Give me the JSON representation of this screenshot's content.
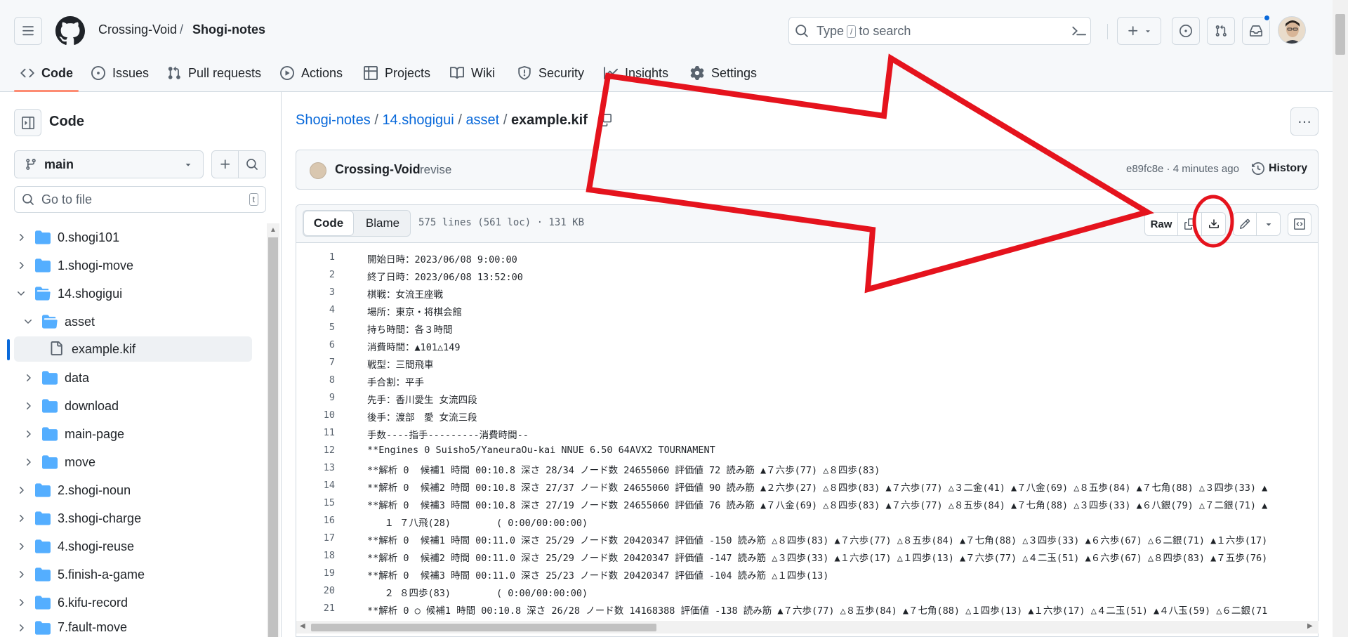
{
  "header": {
    "owner": "Crossing-Void",
    "separator": "/",
    "repo": "Shogi-notes",
    "search_placeholder_prefix": "Type",
    "search_key": "/",
    "search_placeholder_suffix": "to search",
    "create_icon": "plus-icon"
  },
  "nav": {
    "tabs": [
      {
        "label": "Code",
        "icon": "code-icon"
      },
      {
        "label": "Issues",
        "icon": "issue-icon"
      },
      {
        "label": "Pull requests",
        "icon": "pull-request-icon"
      },
      {
        "label": "Actions",
        "icon": "play-icon"
      },
      {
        "label": "Projects",
        "icon": "table-icon"
      },
      {
        "label": "Wiki",
        "icon": "book-icon"
      },
      {
        "label": "Security",
        "icon": "shield-icon"
      },
      {
        "label": "Insights",
        "icon": "graph-icon"
      },
      {
        "label": "Settings",
        "icon": "gear-icon"
      }
    ]
  },
  "sidebar": {
    "title": "Code",
    "branch": "main",
    "goto_placeholder": "Go to file",
    "goto_key": "t",
    "tree": [
      {
        "name": "0.shogi101"
      },
      {
        "name": "1.shogi-move"
      },
      {
        "name": "14.shogigui"
      },
      {
        "name": "asset"
      },
      {
        "name": "example.kif"
      },
      {
        "name": "data"
      },
      {
        "name": "download"
      },
      {
        "name": "main-page"
      },
      {
        "name": "move"
      },
      {
        "name": "2.shogi-noun"
      },
      {
        "name": "3.shogi-charge"
      },
      {
        "name": "4.shogi-reuse"
      },
      {
        "name": "5.finish-a-game"
      },
      {
        "name": "6.kifu-record"
      },
      {
        "name": "7.fault-move"
      }
    ]
  },
  "path": {
    "parts": [
      "Shogi-notes",
      "14.shogigui",
      "asset"
    ],
    "sep": "/",
    "file": "example.kif"
  },
  "commit": {
    "author": "Crossing-Void",
    "message": "revise",
    "hash_time": "e89fc8e · 4 minutes ago",
    "history": "History"
  },
  "file_header": {
    "code_tab": "Code",
    "blame_tab": "Blame",
    "meta": "575 lines (561 loc) · 131 KB",
    "raw": "Raw"
  },
  "code_lines": [
    {
      "n": "1",
      "text": "開始日時：2023/06/08 9:00:00"
    },
    {
      "n": "2",
      "text": "終了日時：2023/06/08 13:52:00"
    },
    {
      "n": "3",
      "text": "棋戦：女流王座戦"
    },
    {
      "n": "4",
      "text": "場所：東京・将棋会館"
    },
    {
      "n": "5",
      "text": "持ち時間：各３時間"
    },
    {
      "n": "6",
      "text": "消費時間：▲101△149"
    },
    {
      "n": "7",
      "text": "戦型：三間飛車"
    },
    {
      "n": "8",
      "text": "手合割：平手"
    },
    {
      "n": "9",
      "text": "先手：香川愛生 女流四段"
    },
    {
      "n": "10",
      "text": "後手：渡部　愛 女流三段"
    },
    {
      "n": "11",
      "text": "手数----指手---------消費時間--"
    },
    {
      "n": "12",
      "text": "**Engines 0 Suisho5/YaneuraOu-kai NNUE 6.50 64AVX2 TOURNAMENT"
    },
    {
      "n": "13",
      "text": "**解析 0  候補1 時間 00:10.8 深さ 28/34 ノード数 24655060 評価値 72 読み筋 ▲７六歩(77) △８四歩(83)"
    },
    {
      "n": "14",
      "text": "**解析 0  候補2 時間 00:10.8 深さ 27/37 ノード数 24655060 評価値 90 読み筋 ▲２六歩(27) △８四歩(83) ▲７六歩(77) △３二金(41) ▲７八金(69) △８五歩(84) ▲７七角(88) △３四歩(33) ▲"
    },
    {
      "n": "15",
      "text": "**解析 0  候補3 時間 00:10.8 深さ 27/19 ノード数 24655060 評価値 76 読み筋 ▲７八金(69) △８四歩(83) ▲７六歩(77) △８五歩(84) ▲７七角(88) △３四歩(33) ▲６八銀(79) △７二銀(71) ▲"
    },
    {
      "n": "16",
      "text": "   １ ７八飛(28)        ( 0:00/00:00:00)"
    },
    {
      "n": "17",
      "text": "**解析 0  候補1 時間 00:11.0 深さ 25/29 ノード数 20420347 評価値 -150 読み筋 △８四歩(83) ▲７六歩(77) △８五歩(84) ▲７七角(88) △３四歩(33) ▲６六歩(67) △６二銀(71) ▲１六歩(17)"
    },
    {
      "n": "18",
      "text": "**解析 0  候補2 時間 00:11.0 深さ 25/29 ノード数 20420347 評価値 -147 読み筋 △３四歩(33) ▲１六歩(17) △１四歩(13) ▲７六歩(77) △４二玉(51) ▲６六歩(67) △８四歩(83) ▲７五歩(76)"
    },
    {
      "n": "19",
      "text": "**解析 0  候補3 時間 00:11.0 深さ 25/23 ノード数 20420347 評価値 -104 読み筋 △１四歩(13)"
    },
    {
      "n": "20",
      "text": "   ２ ８四歩(83)        ( 0:00/00:00:00)"
    },
    {
      "n": "21",
      "text": "**解析 0 ○ 候補1 時間 00:10.8 深さ 26/28 ノード数 14168388 評価値 -138 読み筋 ▲７六歩(77) △８五歩(84) ▲７七角(88) △１四歩(13) ▲１六歩(17) △４二玉(51) ▲４八玉(59) △６二銀(71"
    }
  ],
  "colors": {
    "accent": "#0969da",
    "tab_underline": "#fd8c73",
    "annotation_red": "#e5131d"
  }
}
